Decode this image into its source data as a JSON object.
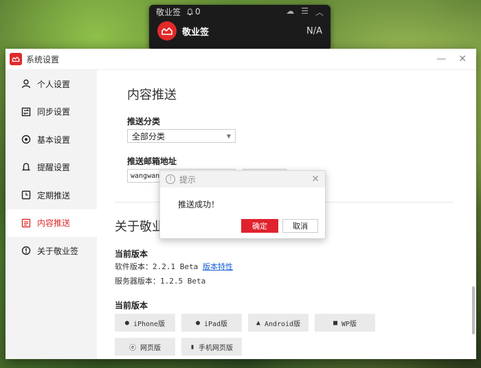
{
  "widget": {
    "title": "敬业签",
    "bell_count": "0",
    "name": "敬业签",
    "status": "N/A"
  },
  "window": {
    "title": "系统设置"
  },
  "sidebar": {
    "items": [
      {
        "label": "个人设置"
      },
      {
        "label": "同步设置"
      },
      {
        "label": "基本设置"
      },
      {
        "label": "提醒设置"
      },
      {
        "label": "定期推送"
      },
      {
        "label": "内容推送"
      },
      {
        "label": "关于敬业签"
      }
    ],
    "active_index": 5
  },
  "content": {
    "heading": "内容推送",
    "category_label": "推送分类",
    "category_value": "全部分类",
    "email_label": "推送邮箱地址",
    "email_value": "wangwang",
    "about_heading": "关于敬业",
    "version_heading": "当前版本",
    "software_version_label": "软件版本：2.2.1 Beta",
    "release_notes_link": "版本特性",
    "server_version_label": "服务器版本：1.2.5 Beta",
    "platforms_heading": "当前版本",
    "platforms": [
      "iPhone版",
      "iPad版",
      "Android版",
      "WP版",
      "网页版",
      "手机网页版"
    ]
  },
  "dialog": {
    "title": "提示",
    "message": "推送成功！",
    "ok": "确定",
    "cancel": "取消"
  },
  "colors": {
    "accent": "#e02a2a",
    "link": "#1a5fd6"
  }
}
